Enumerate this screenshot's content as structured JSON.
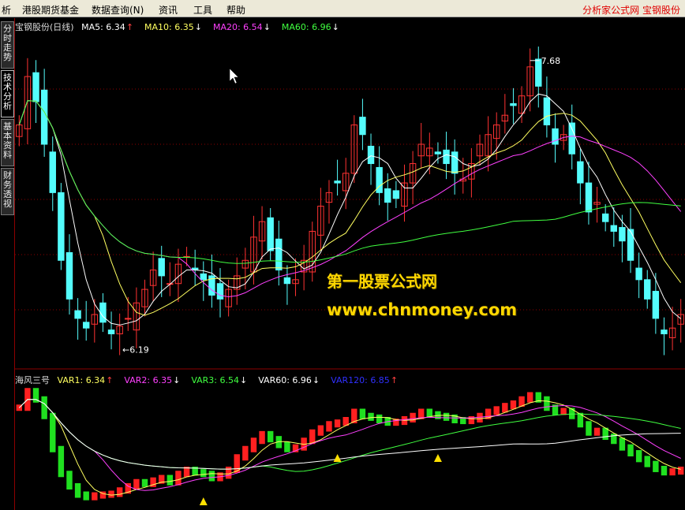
{
  "menu": {
    "items": [
      "析",
      "港股期货基金",
      "数据查询(N)",
      "资讯",
      "工具",
      "帮助"
    ],
    "title": "分析家公式网  宝钢股份"
  },
  "side_tabs": [
    "分时走势",
    "技术分析",
    "基本资料",
    "财务透视"
  ],
  "main_legend": {
    "name": "宝钢股份(日线)",
    "items": [
      {
        "label": "MA5: 6.34",
        "arrow": "↑",
        "color": "#ffffff"
      },
      {
        "label": "MA10: 6.35",
        "arrow": "↓",
        "color": "#ffff60"
      },
      {
        "label": "MA20: 6.54",
        "arrow": "↓",
        "color": "#ff40ff"
      },
      {
        "label": "MA60: 6.96",
        "arrow": "↓",
        "color": "#40ff40"
      }
    ]
  },
  "sub_legend": {
    "name": "海风三号",
    "items": [
      {
        "label": "VAR1: 6.34",
        "arrow": "↑",
        "color": "#ffff60"
      },
      {
        "label": "VAR2: 6.35",
        "arrow": "↓",
        "color": "#ff40ff"
      },
      {
        "label": "VAR3: 6.54",
        "arrow": "↓",
        "color": "#40ff40"
      },
      {
        "label": "VAR60: 6.96",
        "arrow": "↓",
        "color": "#ffffff"
      },
      {
        "label": "VAR120: 6.85",
        "arrow": "↑",
        "color": "#3030ff"
      }
    ]
  },
  "annotations": {
    "high": "7.68",
    "low": "6.19"
  },
  "watermark": {
    "line1": "第一股票公式网",
    "line2": "www.chnmoney.com"
  },
  "colors": {
    "up": "#ff3232",
    "down": "#54fcfc",
    "sub_up": "#ff2020",
    "sub_down": "#20e020",
    "grid": "#8c0000",
    "signal": "#ffe000"
  },
  "chart_data": {
    "type": "candlestick",
    "ylim": [
      6.1,
      7.75
    ],
    "close": [
      7.3,
      7.55,
      7.42,
      7.2,
      6.95,
      6.6,
      6.4,
      6.3,
      6.25,
      6.32,
      6.28,
      6.22,
      6.26,
      6.3,
      6.38,
      6.45,
      6.55,
      6.52,
      6.48,
      6.58,
      6.62,
      6.55,
      6.5,
      6.42,
      6.4,
      6.45,
      6.52,
      6.6,
      6.72,
      6.8,
      6.65,
      6.55,
      6.48,
      6.5,
      6.6,
      6.75,
      6.88,
      6.95,
      7.0,
      7.05,
      7.3,
      7.25,
      7.1,
      6.95,
      6.9,
      6.92,
      7.0,
      7.1,
      7.2,
      7.18,
      7.15,
      7.1,
      7.05,
      7.02,
      7.1,
      7.2,
      7.25,
      7.3,
      7.35,
      7.4,
      7.45,
      7.6,
      7.5,
      7.3,
      7.2,
      7.25,
      7.15,
      7.0,
      6.85,
      6.9,
      6.8,
      6.75,
      6.7,
      6.6,
      6.5,
      6.4,
      6.3,
      6.22,
      6.25,
      6.32
    ],
    "sub_values": [
      7.1,
      7.3,
      7.2,
      7.0,
      6.6,
      6.3,
      6.15,
      6.05,
      6.02,
      6.04,
      6.05,
      6.06,
      6.1,
      6.15,
      6.2,
      6.18,
      6.22,
      6.25,
      6.2,
      6.3,
      6.35,
      6.32,
      6.3,
      6.25,
      6.28,
      6.35,
      6.5,
      6.6,
      6.7,
      6.78,
      6.72,
      6.65,
      6.6,
      6.62,
      6.7,
      6.8,
      6.85,
      6.9,
      6.92,
      6.95,
      7.05,
      7.0,
      6.98,
      6.95,
      6.92,
      6.93,
      6.96,
      7.0,
      7.05,
      7.02,
      7.0,
      6.98,
      6.95,
      6.94,
      6.96,
      7.0,
      7.05,
      7.08,
      7.12,
      7.15,
      7.2,
      7.25,
      7.2,
      7.1,
      7.05,
      7.06,
      7.0,
      6.9,
      6.8,
      6.82,
      6.75,
      6.7,
      6.62,
      6.55,
      6.48,
      6.42,
      6.36,
      6.32,
      6.33,
      6.35
    ]
  }
}
